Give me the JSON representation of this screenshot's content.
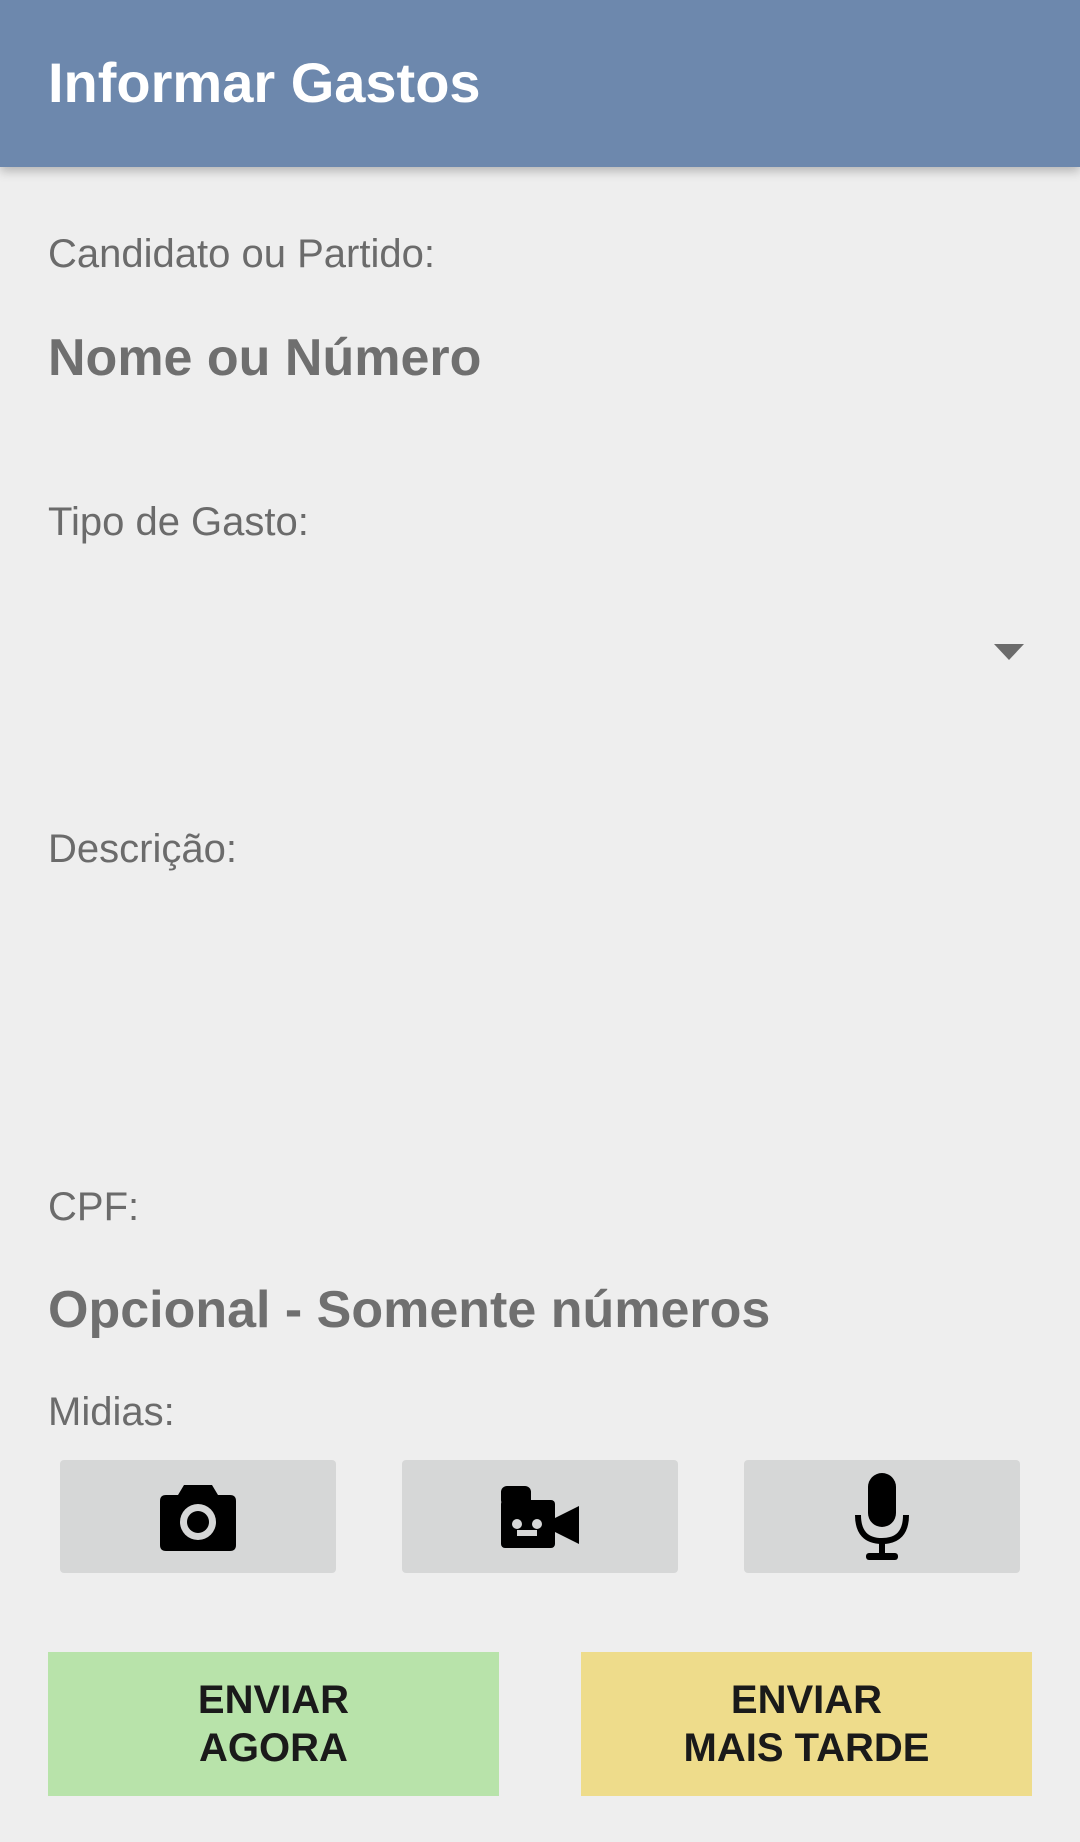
{
  "appbar": {
    "title": "Informar Gastos"
  },
  "form": {
    "candidate_label": "Candidato ou Partido:",
    "candidate_placeholder": "Nome ou Número",
    "expense_type_label": "Tipo de Gasto:",
    "description_label": "Descrição:",
    "cpf_label": "CPF:",
    "cpf_placeholder": "Opcional - Somente números",
    "media_label": "Midias:"
  },
  "media": {
    "buttons": [
      {
        "icon": "camera-icon"
      },
      {
        "icon": "video-camera-icon"
      },
      {
        "icon": "microphone-icon"
      }
    ]
  },
  "actions": {
    "send_now": "ENVIAR\nAGORA",
    "send_later": "ENVIAR\nMAIS TARDE",
    "send_now_color": "#b8e3aa",
    "send_later_color": "#eedc8b"
  },
  "colors": {
    "appbar": "#6d88ad",
    "background": "#eeeeee",
    "media_button": "#d6d7d7"
  }
}
